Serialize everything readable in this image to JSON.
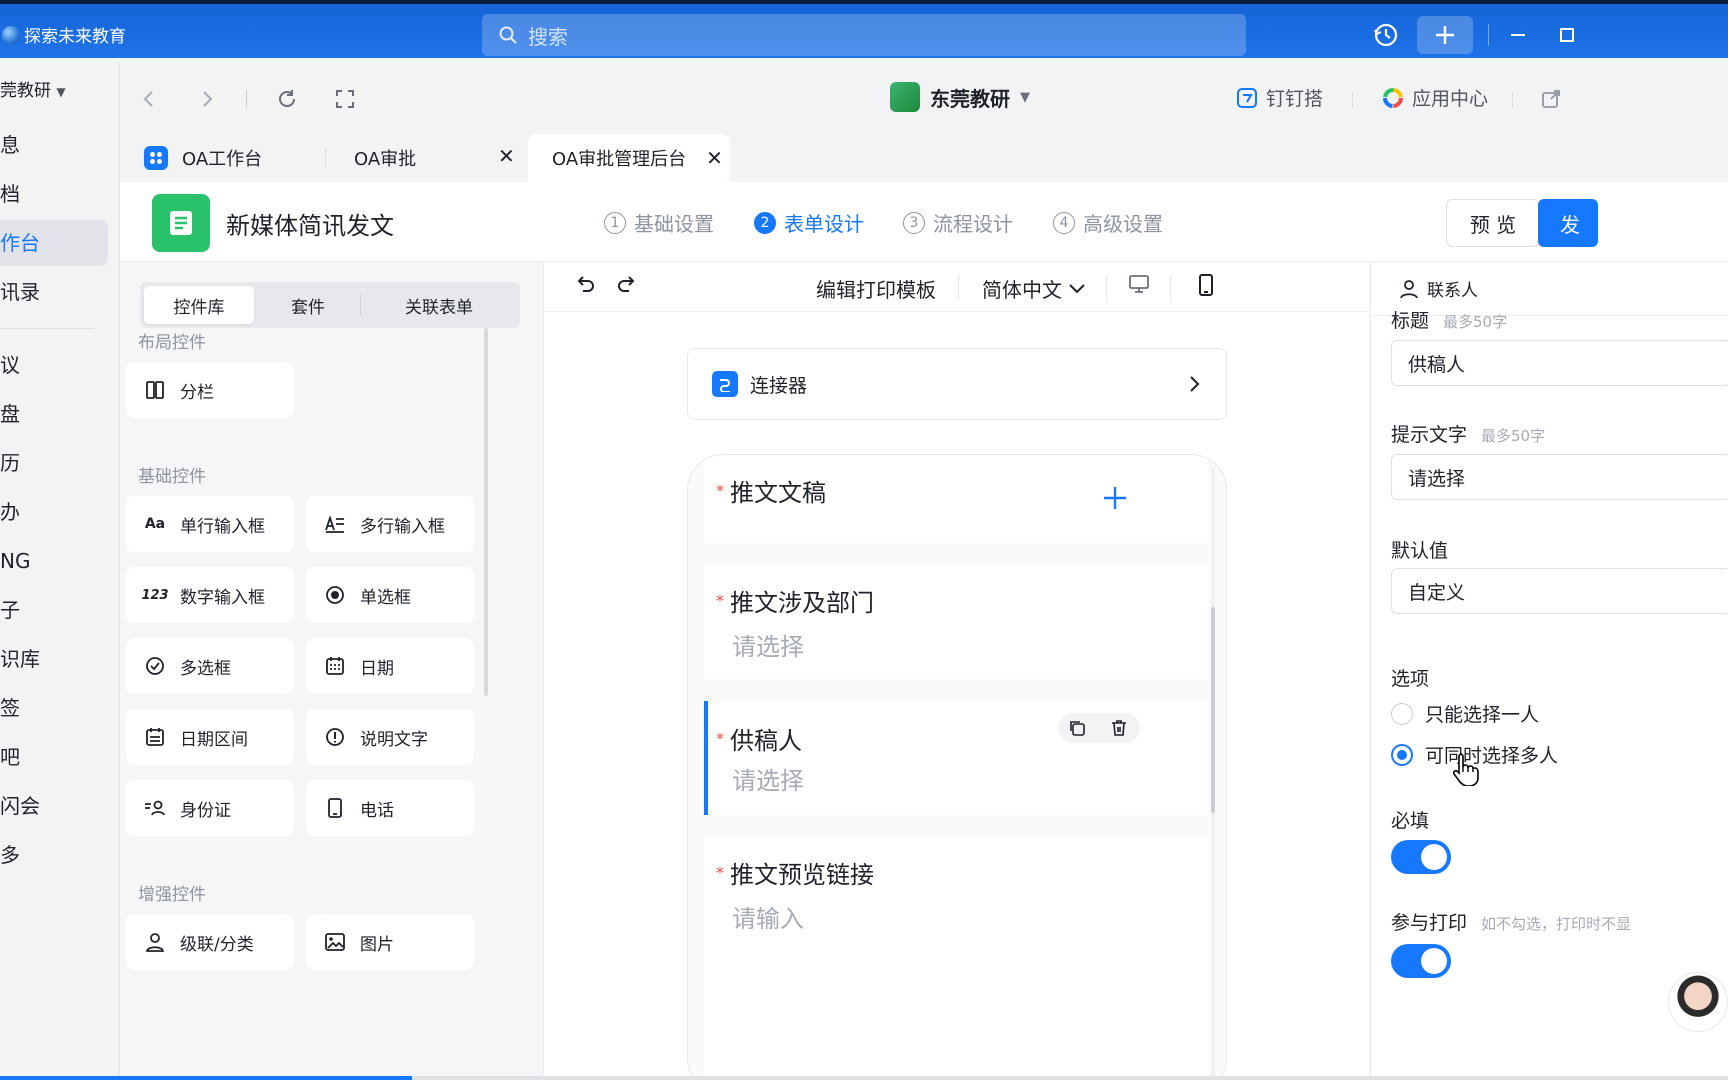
{
  "titlebar": {
    "app_name": "探索未来教育",
    "search_placeholder": "搜索"
  },
  "rail": {
    "items": [
      "莞教研",
      "息",
      "档",
      "作台",
      "讯录",
      "议",
      "盘",
      "历",
      "办",
      "NG",
      "子",
      "识库",
      "签",
      "吧",
      "闪会",
      "多"
    ]
  },
  "nav": {
    "org_name": "东莞教研",
    "dingda": "钉钉搭",
    "app_center": "应用中心"
  },
  "tabs": [
    {
      "label": "OA工作台"
    },
    {
      "label": "OA审批"
    },
    {
      "label": "OA审批管理后台"
    }
  ],
  "form_header": {
    "title": "新媒体简讯发文",
    "steps": [
      {
        "num": "1",
        "label": "基础设置"
      },
      {
        "num": "2",
        "label": "表单设计"
      },
      {
        "num": "3",
        "label": "流程设计"
      },
      {
        "num": "4",
        "label": "高级设置"
      }
    ],
    "preview": "预 览",
    "publish": "发"
  },
  "left_panel": {
    "tabs": [
      "控件库",
      "套件",
      "关联表单"
    ],
    "layout_title": "布局控件",
    "layout_items": [
      "分栏"
    ],
    "basic_title": "基础控件",
    "basic_items": [
      "单行输入框",
      "多行输入框",
      "数字输入框",
      "单选框",
      "多选框",
      "日期",
      "日期区间",
      "说明文字",
      "身份证",
      "电话"
    ],
    "enhanced_title": "增强控件",
    "enhanced_items": [
      "级联/分类",
      "图片"
    ]
  },
  "canvas": {
    "edit_print": "编辑打印模板",
    "language": "简体中文",
    "connector": "连接器",
    "fields": [
      {
        "label": "推文文稿",
        "placeholder": ""
      },
      {
        "label": "推文涉及部门",
        "placeholder": "请选择"
      },
      {
        "label": "供稿人",
        "placeholder": "请选择"
      },
      {
        "label": "推文预览链接",
        "placeholder": "请输入"
      }
    ]
  },
  "right_panel": {
    "header": "联系人",
    "title_label": "标题",
    "title_hint": "最多50字",
    "title_value": "供稿人",
    "tip_label": "提示文字",
    "tip_hint": "最多50字",
    "tip_value": "请选择",
    "default_label": "默认值",
    "default_value": "自定义",
    "options_label": "选项",
    "option_single": "只能选择一人",
    "option_multi": "可同时选择多人",
    "required_label": "必填",
    "print_label": "参与打印",
    "print_hint": "如不勾选，打印时不显"
  }
}
